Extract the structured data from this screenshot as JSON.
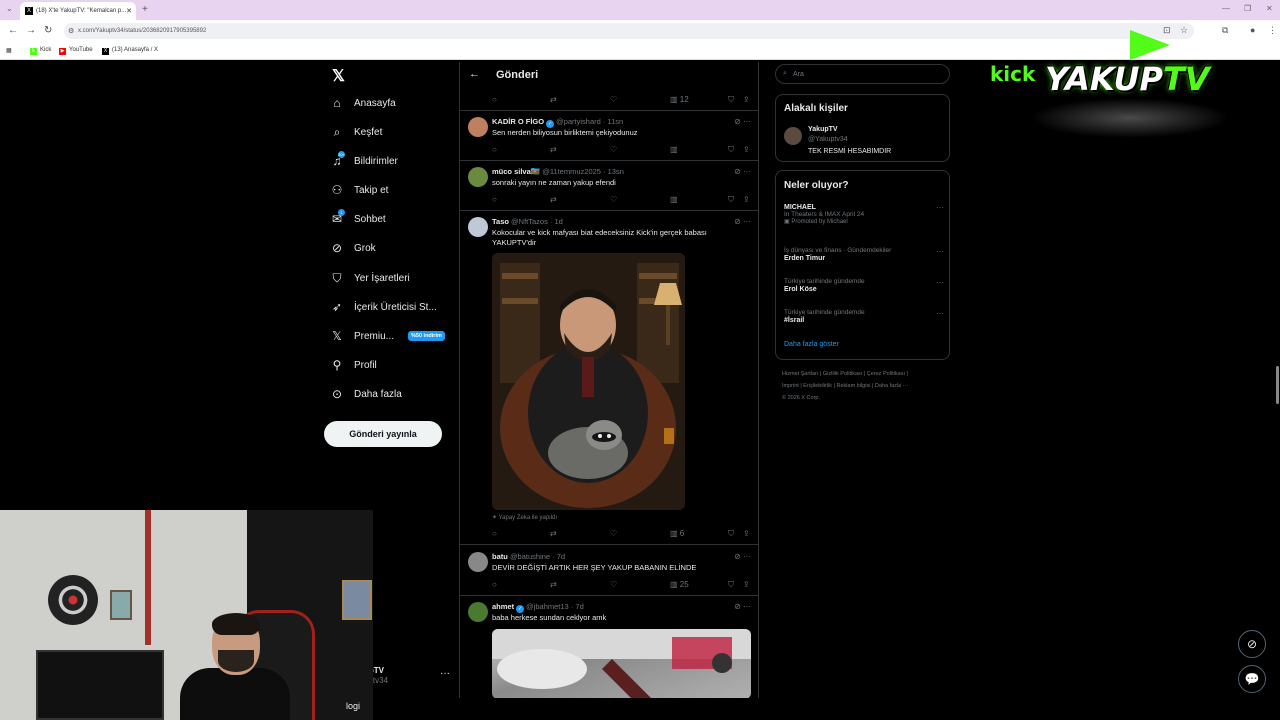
{
  "browser": {
    "tab_title": "(18) X'te YakupTV: \"Kemalcan p...",
    "tab_favicon": "X",
    "url": "x.com/Yakuptv34/status/2036820917905395892",
    "bookmarks": [
      {
        "label": "Kick",
        "icon": "kick-icon",
        "color": "#53fc18"
      },
      {
        "label": "YouTube",
        "icon": "youtube-icon",
        "color": "#ff0000"
      },
      {
        "label": "(13) Anasayfa / X",
        "icon": "x-icon",
        "color": "#000000"
      }
    ]
  },
  "sidebar": {
    "items": [
      {
        "label": "Anasayfa",
        "icon": "home-icon"
      },
      {
        "label": "Keşfet",
        "icon": "search-icon"
      },
      {
        "label": "Bildirimler",
        "icon": "bell-icon",
        "badge": "20+"
      },
      {
        "label": "Takip et",
        "icon": "add-user-icon"
      },
      {
        "label": "Sohbet",
        "icon": "chat-icon",
        "badge": "1"
      },
      {
        "label": "Grok",
        "icon": "grok-icon"
      },
      {
        "label": "Yer İşaretleri",
        "icon": "bookmark-icon"
      },
      {
        "label": "İçerik Üreticisi St...",
        "icon": "rocket-icon"
      },
      {
        "label": "Premiu...",
        "icon": "x-icon",
        "promo": "%50 indirim"
      },
      {
        "label": "Profil",
        "icon": "person-icon"
      },
      {
        "label": "Daha fazla",
        "icon": "more-circle-icon"
      }
    ],
    "post_button": "Gönderi yayınla",
    "account_name": "upTV",
    "account_handle": "uptv34"
  },
  "webcam": {
    "brand_text": "logi"
  },
  "feed": {
    "header_title": "Gönderi",
    "top_action_count": "12",
    "tweets": [
      {
        "name": "KADİR O FİGO",
        "verified": true,
        "handle": "@partyishard · 11sn",
        "text": "Sen nerden biliyosun birliktemi çekiyodunuz",
        "views": "",
        "avatar_color": "#c08060"
      },
      {
        "name": "müco silva🇦🇿",
        "verified": false,
        "handle": "@11temmuz2025 · 13sn",
        "text": "sonraki yayın ne zaman yakup efendi",
        "views": "",
        "avatar_color": "#6a8a40"
      },
      {
        "name": "Taso",
        "verified": false,
        "handle": "@NftTazos · 1d",
        "text": "Kokocular ve kick mafyası biat edeceksiniz Kick'in gerçek babası YAKUPTV'dir",
        "views": "6",
        "avatar_color": "#c0c8d8",
        "ai_label": "Yapay Zeka ile yapıldı"
      },
      {
        "name": "batu",
        "verified": false,
        "handle": "@batushine · 7d",
        "text": "DEVİR DEĞİŞTİ ARTIK HER ŞEY YAKUP BABANIN ELİNDE",
        "views": "25",
        "avatar_color": "#888888"
      },
      {
        "name": "ahmet",
        "verified": true,
        "handle": "@jbahmet13 · 7d",
        "text": "baba herkese sundan ceklyor amk",
        "views": "",
        "avatar_color": "#4a7a30"
      }
    ]
  },
  "right": {
    "search_placeholder": "Ara",
    "relevant_title": "Alakalı kişiler",
    "relevant_person": {
      "name": "YakupTV",
      "handle": "@Yakuptv34",
      "bio": "TEK RESMİ HESABIMDIR"
    },
    "trends_title": "Neler oluyor?",
    "trends": [
      {
        "category": "MICHAEL",
        "name": "In Theaters & IMAX April 24",
        "promo": "Promoted by Michael"
      },
      {
        "category": "İş dünyası ve finans · Gündemdekiler",
        "name": "Erden Timur",
        "promo": ""
      },
      {
        "category": "Türkiye tarihinde gündemde",
        "name": "Erol Köse",
        "promo": ""
      },
      {
        "category": "Türkiye tarihinde gündemde",
        "name": "#İsrail",
        "promo": ""
      }
    ],
    "show_more": "Daha fazla göster",
    "footer_lines": [
      "Hizmet Şartları | Gizlilik Politikası | Çerez Politikası |",
      "Imprint | Erişilebilirlik | Reklam bilgisi | Daha fazla ···",
      "© 2026 X Corp."
    ]
  },
  "overlay": {
    "kick": "kick",
    "brand_main": "YAKUP",
    "brand_tv": "TV"
  },
  "colors": {
    "accent": "#1d9bf0",
    "kick_green": "#53fc18",
    "border": "#2f3336",
    "muted": "#71767b"
  }
}
